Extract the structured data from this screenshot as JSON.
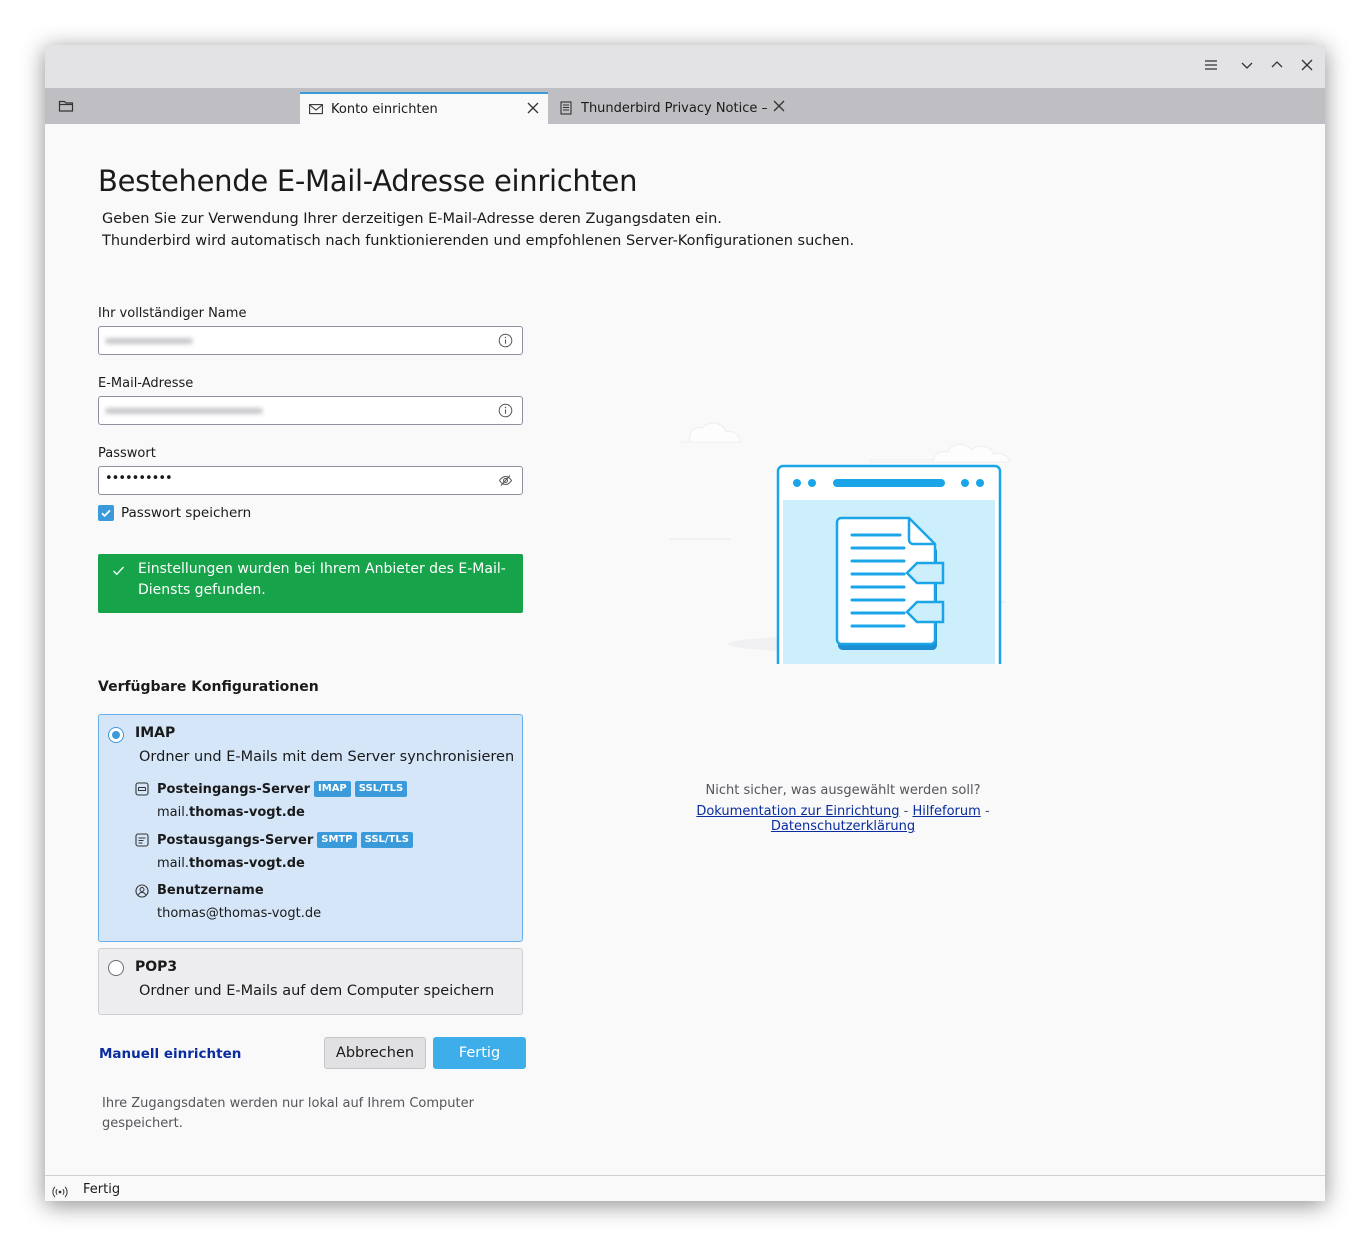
{
  "window": {
    "controls": [
      "menu",
      "minimize",
      "maximize",
      "close"
    ]
  },
  "tabs": [
    {
      "label": "Konto einrichten",
      "icon": "mail-setup-icon",
      "active": true
    },
    {
      "label": "Thunderbird Privacy Notice —",
      "icon": "document-icon",
      "active": false
    }
  ],
  "page": {
    "title": "Bestehende E-Mail-Adresse einrichten",
    "intro_line1": "Geben Sie zur Verwendung Ihrer derzeitigen E-Mail-Adresse deren Zugangsdaten ein.",
    "intro_line2": "Thunderbird wird automatisch nach funktionierenden und empfohlenen Server-Konfigurationen suchen."
  },
  "form": {
    "name_label": "Ihr vollständiger Name",
    "email_label": "E-Mail-Adresse",
    "password_label": "Passwort",
    "password_value": "••••••••••",
    "remember_password_label": "Passwort speichern",
    "remember_password_checked": true
  },
  "success_message": "Einstellungen wurden bei Ihrem Anbieter des E-Mail-Diensts gefunden.",
  "configs": {
    "title": "Verfügbare Konfigurationen",
    "imap": {
      "name": "IMAP",
      "description": "Ordner und E-Mails mit dem Server synchronisieren",
      "incoming_label": "Posteingangs-Server",
      "incoming_badges": [
        "IMAP",
        "SSL/TLS"
      ],
      "incoming_host_prefix": "mail.",
      "incoming_host_domain": "thomas-vogt.de",
      "outgoing_label": "Postausgangs-Server",
      "outgoing_badges": [
        "SMTP",
        "SSL/TLS"
      ],
      "outgoing_host_prefix": "mail.",
      "outgoing_host_domain": "thomas-vogt.de",
      "username_label": "Benutzername",
      "username_value": "thomas@thomas-vogt.de"
    },
    "pop3": {
      "name": "POP3",
      "description": "Ordner und E-Mails auf dem Computer speichern"
    }
  },
  "actions": {
    "manual_label": "Manuell einrichten",
    "cancel_label": "Abbrechen",
    "done_label": "Fertig"
  },
  "footnote": "Ihre Zugangsdaten werden nur lokal auf Ihrem Computer gespeichert.",
  "help": {
    "question": "Nicht sicher, was ausgewählt werden soll?",
    "link_docs": "Dokumentation zur Einrichtung",
    "link_forum": "Hilfeforum",
    "link_privacy": "Datenschutzerklärung",
    "separator": "-"
  },
  "status": {
    "text": "Fertig"
  },
  "colors": {
    "accent": "#3b9ad9",
    "success": "#16a34a",
    "link": "#0a2c9e"
  }
}
